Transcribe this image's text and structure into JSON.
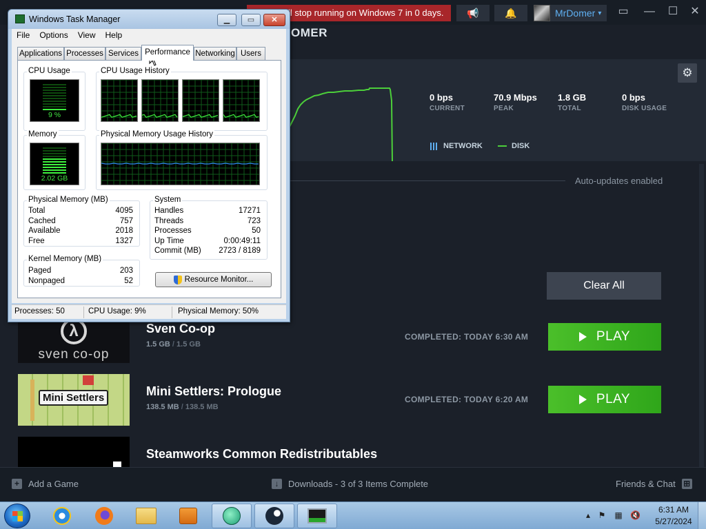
{
  "steam": {
    "banner_text": "ll stop running on Windows 7 in 0 days.",
    "user_name": "MrDomer",
    "header_title": "OMER",
    "stats": [
      {
        "value": "0 bps",
        "label": "CURRENT"
      },
      {
        "value": "70.9 Mbps",
        "label": "PEAK"
      },
      {
        "value": "1.8 GB",
        "label": "TOTAL"
      },
      {
        "value": "0 bps",
        "label": "DISK USAGE"
      }
    ],
    "legend": {
      "network": "NETWORK",
      "disk": "DISK"
    },
    "auto_updates": "Auto-updates enabled",
    "clear_all": "Clear All",
    "downloads": [
      {
        "title": "Sven Co-op",
        "size_done": "1.5 GB",
        "size_total": "1.5 GB",
        "status": "COMPLETED: TODAY 6:30 AM",
        "action": "PLAY",
        "thumb_text": "sven co-op"
      },
      {
        "title": "Mini Settlers: Prologue",
        "size_done": "138.5 MB",
        "size_total": "138.5 MB",
        "status": "COMPLETED: TODAY 6:20 AM",
        "action": "PLAY",
        "thumb_text": "Mini Settlers"
      },
      {
        "title": "Steamworks Common Redistributables"
      }
    ],
    "bottombar": {
      "add_game": "Add a Game",
      "downloads_status": "Downloads - 3 of 3 Items Complete",
      "friends": "Friends & Chat"
    },
    "colors": {
      "accent_blue": "#5fb0f2",
      "play_green": "#3fb41f",
      "banner_red": "#a8262a",
      "chart_green": "#4ccf3a"
    }
  },
  "taskmgr": {
    "title": "Windows Task Manager",
    "menu": [
      "File",
      "Options",
      "View",
      "Help"
    ],
    "tabs": [
      "Applications",
      "Processes",
      "Services",
      "Performance",
      "Networking",
      "Users"
    ],
    "active_tab": "Performance",
    "groups": {
      "cpu_usage": "CPU Usage",
      "cpu_history": "CPU Usage History",
      "memory": "Memory",
      "mem_history": "Physical Memory Usage History",
      "physical_memory": "Physical Memory (MB)",
      "kernel_memory": "Kernel Memory (MB)",
      "system": "System"
    },
    "cpu_value": "9 %",
    "cpu_percent": 9,
    "memory_value": "2.02 GB",
    "memory_percent": 50,
    "physical_memory": [
      {
        "k": "Total",
        "v": "4095"
      },
      {
        "k": "Cached",
        "v": "757"
      },
      {
        "k": "Available",
        "v": "2018"
      },
      {
        "k": "Free",
        "v": "1327"
      }
    ],
    "kernel_memory": [
      {
        "k": "Paged",
        "v": "203"
      },
      {
        "k": "Nonpaged",
        "v": "52"
      }
    ],
    "system": [
      {
        "k": "Handles",
        "v": "17271"
      },
      {
        "k": "Threads",
        "v": "723"
      },
      {
        "k": "Processes",
        "v": "50"
      },
      {
        "k": "Up Time",
        "v": "0:00:49:11"
      },
      {
        "k": "Commit (MB)",
        "v": "2723 / 8189"
      }
    ],
    "resource_monitor": "Resource Monitor...",
    "status": {
      "processes": "Processes: 50",
      "cpu": "CPU Usage: 9%",
      "memory": "Physical Memory: 50%"
    }
  },
  "taskbar": {
    "apps": [
      "internet-explorer",
      "firefox",
      "explorer",
      "media-player",
      "app-green",
      "steam",
      "task-manager"
    ],
    "time": "6:31 AM",
    "date": "5/27/2024"
  }
}
